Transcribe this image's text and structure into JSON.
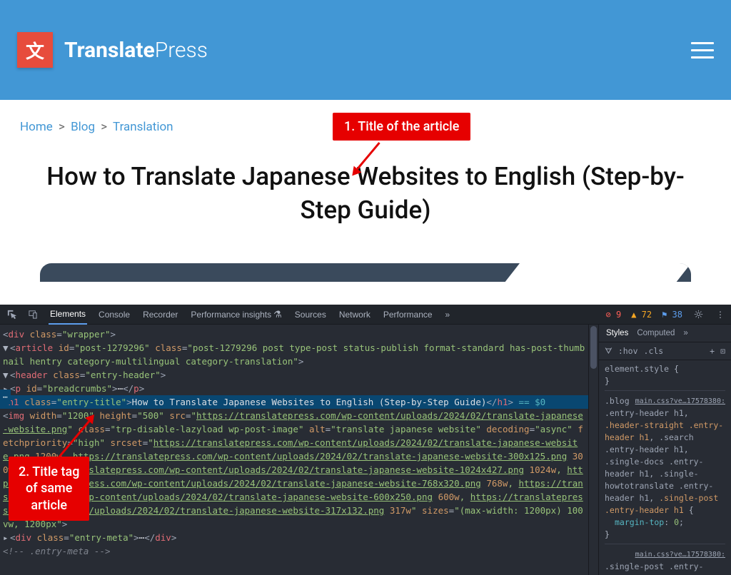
{
  "header": {
    "logo_glyph": "文",
    "logo_bold": "Translate",
    "logo_light": "Press"
  },
  "breadcrumb": {
    "home": "Home",
    "blog": "Blog",
    "current": "Translation",
    "sep": ">"
  },
  "article": {
    "title": "How to Translate Japanese Websites to English (Step-by-Step Guide)"
  },
  "annotations": {
    "a1": "1. Title of the article",
    "a2_l1": "2. Title tag",
    "a2_l2": "of same",
    "a2_l3": "article"
  },
  "devtools": {
    "tabs": {
      "elements": "Elements",
      "console": "Console",
      "recorder": "Recorder",
      "perf_insights": "Performance insights",
      "sources": "Sources",
      "network": "Network",
      "performance": "Performance",
      "more": "»"
    },
    "counts": {
      "errors": "9",
      "warnings": "72",
      "info": "38"
    },
    "styles_tabs": {
      "styles": "Styles",
      "computed": "Computed",
      "more": "»"
    },
    "filter": {
      "funnel": "⧩",
      "hov": ":hov",
      "cls": ".cls",
      "plus": "+"
    },
    "css": {
      "el_style": "element.style",
      "link1": "main.css?ve…17578380:",
      "selectors": ".blog .entry-header h1, .header-straight .entry-header h1, .search .entry-header h1, .single-docs .entry-header h1, .single-howtotranslate .entry-header h1, .single-post .entry-header h1",
      "prop1": "margin-top",
      "val1": "0",
      "link2": "main.css?ve…17578380:",
      "sel2": ".single-post .entry-"
    },
    "dom": {
      "article_open": "<article id=\"post-1279296\" class=\"post-1279296 post type-post status-publish format-standard has-post-thumbnail hentry category-multilingual category-translation\">",
      "header_open": "<header class=\"entry-header\">",
      "p_breadcrumbs": "<p id=\"breadcrumbs\">⋯</p>",
      "h1_open": "<h1 class=\"entry-title\">",
      "h1_text": "How to Translate Japanese Websites to English (Step-by-Step Guide)",
      "h1_close": "</h1>",
      "eq0": " == $0",
      "img_l1": "<img width=\"1200\" height=\"500\" src=\"https://translatepress.com/wp-content/uploads/2024/02/translate-japanese-website.png\" class=\"trp-disable-lazyload wp-post-image\" alt=\"translate japanese website\" decoding=\"async\" fetchpriority=\"high\" srcset=\"https://translatepress.com/wp-content/uploads/2024/02/translate-japanese-website.png 1200w, https://translatepress.com/wp-content/uploads/2024/02/translate-japanese-website-300x125.png 300w, https://translatepress.com/wp-content/uploads/2024/02/translate-japanese-website-1024x427.png 1024w, https://translatepress.com/wp-content/uploads/2024/02/translate-japanese-website-768x320.png 768w, https://translatepress.com/wp-content/uploads/2024/02/translate-japanese-website-600x250.png 600w, https://translatepress.com/wp-content/uploads/2024/02/translate-japanese-website-317x132.png 317w\" sizes=\"(max-width: 1200px) 100vw, 1200px\">",
      "div_meta": "<div class=\"entry-meta\">⋯</div>",
      "comment_meta": "<!-- .entry-meta -->"
    }
  }
}
